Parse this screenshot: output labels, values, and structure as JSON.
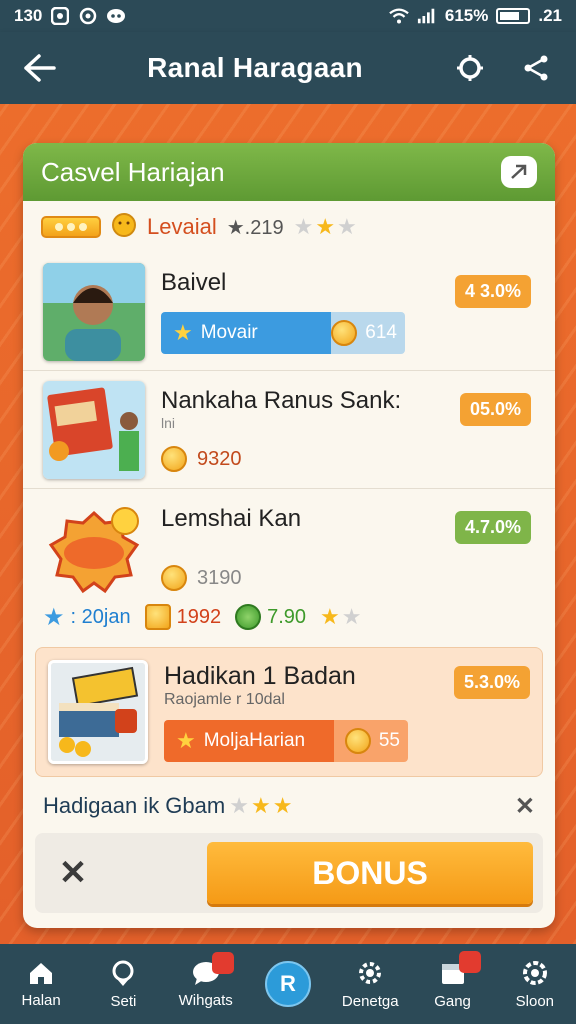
{
  "status": {
    "time": "130",
    "battery": "615%",
    "clock": ".21"
  },
  "appbar": {
    "title": "Ranal Haragaan"
  },
  "card": {
    "title": "Casvel Hariajan",
    "level": {
      "label": "Levaial",
      "count": "★.219"
    },
    "items": [
      {
        "title": "Baivel",
        "percent": "4 3.0%",
        "percent_color": "orange",
        "pill_label": "Movair",
        "pill_value": "614"
      },
      {
        "title": "Nankaha Ranus Sank:",
        "subtitle": "lni",
        "percent": "05.0%",
        "percent_color": "orange",
        "coin_value": "9320"
      },
      {
        "title": "Lemshai Kan",
        "percent": "4.7.0%",
        "percent_color": "green",
        "coin_value": "3190"
      }
    ],
    "stats": {
      "a": ": 20jan",
      "b": "1992",
      "c": "7.90"
    },
    "featured": {
      "title": "Hadikan 1 Badan",
      "subtitle": "Raojamle r 10dal",
      "percent": "5.3.0%",
      "pill_label": "MoljaHarian",
      "pill_value": "55"
    },
    "bottom_text": "Hadigaan ik Gbam",
    "bonus_label": "BONUS"
  },
  "nav": [
    {
      "label": "Halan",
      "icon": "home-icon"
    },
    {
      "label": "Seti",
      "icon": "location-icon"
    },
    {
      "label": "Wihgats",
      "icon": "chat-icon"
    },
    {
      "label": "",
      "icon": "center-icon"
    },
    {
      "label": "Denetga",
      "icon": "gear-icon"
    },
    {
      "label": "Gang",
      "icon": "calendar-icon"
    },
    {
      "label": "Sloon",
      "icon": "settings-icon"
    }
  ]
}
